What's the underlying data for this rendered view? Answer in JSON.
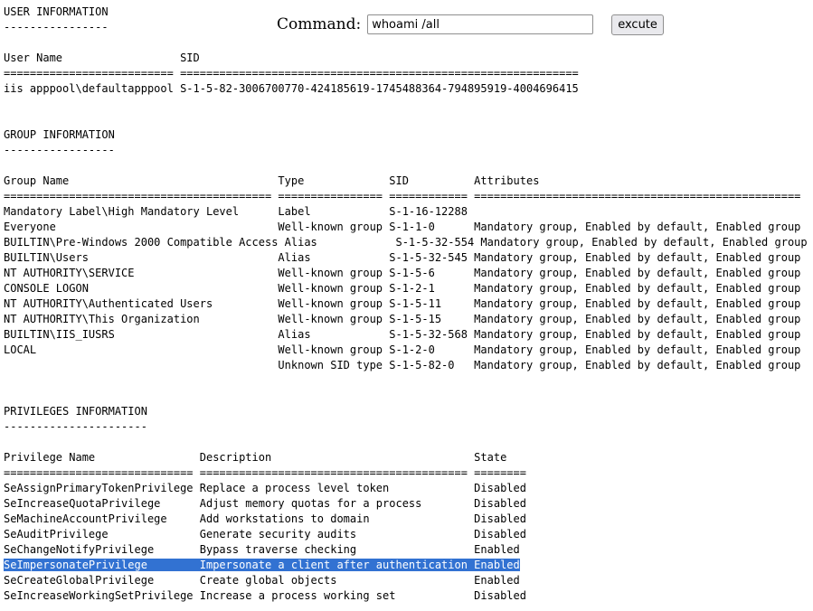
{
  "command_bar": {
    "label": "Command:",
    "input_value": "whoami /all",
    "button_label": "excute"
  },
  "output_lines": [
    "USER INFORMATION",
    "----------------",
    "",
    "User Name                  SID",
    "========================== =============================================================",
    "iis apppool\\defaultapppool S-1-5-82-3006700770-424185619-1745488364-794895919-4004696415",
    "",
    "",
    "GROUP INFORMATION",
    "-----------------",
    "",
    "Group Name                                Type             SID          Attributes",
    "========================================= ================ ============ ==================================================",
    "Mandatory Label\\High Mandatory Level      Label            S-1-16-12288",
    "Everyone                                  Well-known group S-1-1-0      Mandatory group, Enabled by default, Enabled group",
    "BUILTIN\\Pre-Windows 2000 Compatible Access Alias            S-1-5-32-554 Mandatory group, Enabled by default, Enabled group",
    "BUILTIN\\Users                             Alias            S-1-5-32-545 Mandatory group, Enabled by default, Enabled group",
    "NT AUTHORITY\\SERVICE                      Well-known group S-1-5-6      Mandatory group, Enabled by default, Enabled group",
    "CONSOLE LOGON                             Well-known group S-1-2-1      Mandatory group, Enabled by default, Enabled group",
    "NT AUTHORITY\\Authenticated Users          Well-known group S-1-5-11     Mandatory group, Enabled by default, Enabled group",
    "NT AUTHORITY\\This Organization            Well-known group S-1-5-15     Mandatory group, Enabled by default, Enabled group",
    "BUILTIN\\IIS_IUSRS                         Alias            S-1-5-32-568 Mandatory group, Enabled by default, Enabled group",
    "LOCAL                                     Well-known group S-1-2-0      Mandatory group, Enabled by default, Enabled group",
    "                                          Unknown SID type S-1-5-82-0   Mandatory group, Enabled by default, Enabled group",
    "",
    "",
    "PRIVILEGES INFORMATION",
    "----------------------",
    "",
    "Privilege Name                Description                               State",
    "============================= ========================================= ========",
    "SeAssignPrimaryTokenPrivilege Replace a process level token             Disabled",
    "SeIncreaseQuotaPrivilege      Adjust memory quotas for a process        Disabled",
    "SeMachineAccountPrivilege     Add workstations to domain                Disabled",
    "SeAuditPrivilege              Generate security audits                  Disabled",
    "SeChangeNotifyPrivilege       Bypass traverse checking                  Enabled",
    "SeImpersonatePrivilege        Impersonate a client after authentication Enabled",
    "SeCreateGlobalPrivilege       Create global objects                     Enabled",
    "SeIncreaseWorkingSetPrivilege Increase a process working set            Disabled"
  ],
  "highlighted_line_index": 36
}
